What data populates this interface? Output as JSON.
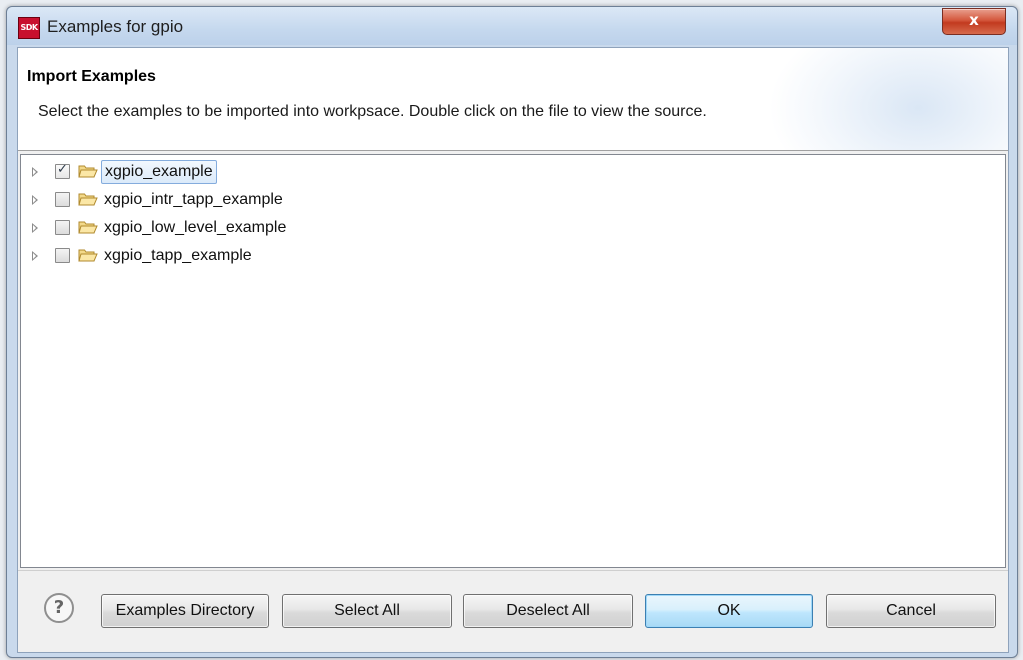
{
  "window": {
    "icon_text": "SDK",
    "title": "Examples for gpio",
    "close_glyph": "x"
  },
  "header": {
    "title": "Import Examples",
    "description": "Select the examples to be imported into workpsace. Double click on the file to view the source."
  },
  "tree": {
    "items": [
      {
        "label": "xgpio_example",
        "checked": true,
        "selected": true,
        "icon": "folder-icon"
      },
      {
        "label": "xgpio_intr_tapp_example",
        "checked": false,
        "selected": false,
        "icon": "folder-icon"
      },
      {
        "label": "xgpio_low_level_example",
        "checked": false,
        "selected": false,
        "icon": "folder-icon"
      },
      {
        "label": "xgpio_tapp_example",
        "checked": false,
        "selected": false,
        "icon": "folder-icon"
      }
    ]
  },
  "footer": {
    "help_glyph": "?",
    "buttons": {
      "examples_directory": "Examples Directory",
      "select_all": "Select All",
      "deselect_all": "Deselect All",
      "ok": "OK",
      "cancel": "Cancel"
    }
  },
  "colors": {
    "accent": "#3c7fb1",
    "selection": "#dbeafa",
    "close_button": "#c23a1f",
    "folder": "#e9c870"
  }
}
